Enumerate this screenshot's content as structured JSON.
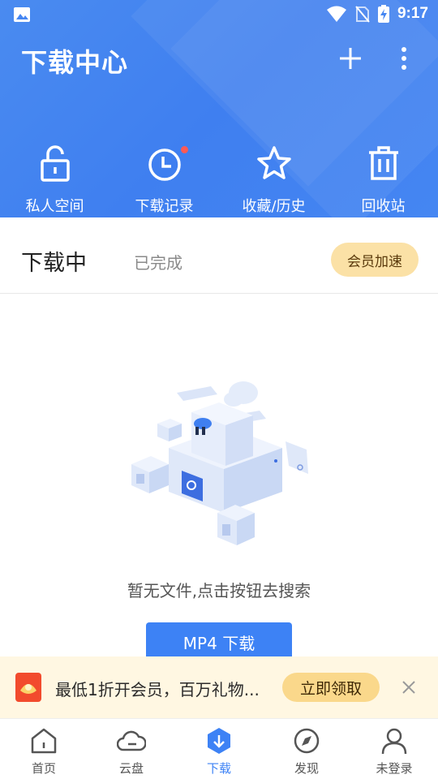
{
  "status_bar": {
    "time": "9:17"
  },
  "header": {
    "title": "下载中心"
  },
  "quick_actions": [
    {
      "label": "私人空间",
      "icon": "unlock-icon"
    },
    {
      "label": "下载记录",
      "icon": "clock-icon",
      "badge": true
    },
    {
      "label": "收藏/历史",
      "icon": "star-icon"
    },
    {
      "label": "回收站",
      "icon": "trash-icon"
    }
  ],
  "tabs": {
    "active": "下载中",
    "inactive": "已完成"
  },
  "vip_button": "会员加速",
  "empty_state": {
    "text": "暂无文件,点击按钮去搜索",
    "button": "MP4 下载"
  },
  "promo": {
    "text": "最低1折开会员，百万礼物...",
    "button": "立即领取"
  },
  "bottom_nav": [
    {
      "label": "首页",
      "icon": "home-icon"
    },
    {
      "label": "云盘",
      "icon": "cloud-icon"
    },
    {
      "label": "下载",
      "icon": "download-icon",
      "active": true
    },
    {
      "label": "发现",
      "icon": "compass-icon"
    },
    {
      "label": "未登录",
      "icon": "user-icon"
    }
  ],
  "colors": {
    "primary": "#3d82f5",
    "header": "#4586f2",
    "vip": "#fbe1a6",
    "promo_bg": "#fff7e2",
    "badge": "#ff5a55"
  }
}
